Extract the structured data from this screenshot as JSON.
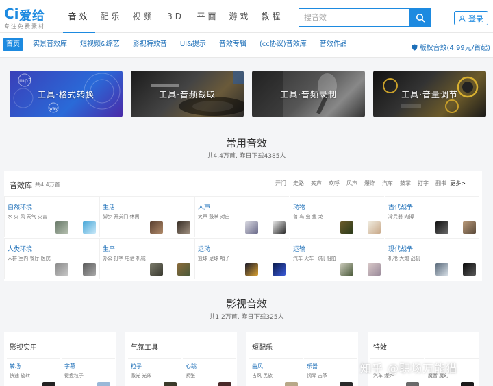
{
  "brand": {
    "logo_mark": "Ci",
    "name": "爱给",
    "slogan": "专注免费素材"
  },
  "nav": [
    {
      "label": "音效",
      "active": true
    },
    {
      "label": "配乐"
    },
    {
      "label": "视频"
    },
    {
      "label": "3D"
    },
    {
      "label": "平面"
    },
    {
      "label": "游戏"
    },
    {
      "label": "教程"
    }
  ],
  "search": {
    "placeholder": "搜音效",
    "value": ""
  },
  "login_label": "登录",
  "subnav": [
    {
      "label": "首页",
      "active": true
    },
    {
      "label": "实景音效库"
    },
    {
      "label": "短视频&综艺"
    },
    {
      "label": "影视特效音"
    },
    {
      "label": "UI&提示"
    },
    {
      "label": "音效专辑"
    },
    {
      "label": "(cc协议)音效库"
    },
    {
      "label": "音效作品"
    }
  ],
  "copyright_label": "版权音效(4.99元/首起)",
  "banners": [
    {
      "label": "工具·格式转换",
      "icon": "mp3-wav-icon"
    },
    {
      "label": "工具·音频截取",
      "icon": "turntable-icon"
    },
    {
      "label": "工具·音频录制",
      "icon": "microphone-icon"
    },
    {
      "label": "工具·音量调节",
      "icon": "mixer-knob-icon"
    }
  ],
  "common": {
    "title": "常用音效",
    "subtitle": "共4.4万首, 昨日下载4385人"
  },
  "library": {
    "title": "音效库",
    "count": "共4.4万首",
    "tags": [
      "开门",
      "走路",
      "笑声",
      "欢呼",
      "风声",
      "爆炸",
      "汽车",
      "鼓掌",
      "打字",
      "翻书"
    ],
    "more": "更多>",
    "cells": [
      {
        "name": "自然环境",
        "desc": "水 火 风 天气 灾害"
      },
      {
        "name": "生活",
        "desc": "脚步 开关门 休闲"
      },
      {
        "name": "人声",
        "desc": "笑声 鼓掌 对白"
      },
      {
        "name": "动物",
        "desc": "兽 鸟 虫 鱼 龙"
      },
      {
        "name": "古代战争",
        "desc": "冷兵器 肉搏"
      },
      {
        "name": "人类环境",
        "desc": "人群 室内 餐厅 医院"
      },
      {
        "name": "生产",
        "desc": "办公 打字 电话 机械"
      },
      {
        "name": "运动",
        "desc": "篮球 足球 哨子"
      },
      {
        "name": "运输",
        "desc": "汽车 火车 飞机 船舶"
      },
      {
        "name": "现代战争",
        "desc": "机枪 大炮 战机"
      }
    ]
  },
  "film": {
    "title": "影视音效",
    "subtitle": "共1.2万首, 昨日下载325人"
  },
  "cards": [
    {
      "title": "影视实用",
      "cells": [
        {
          "name": "转场",
          "desc": "快速 旋转"
        },
        {
          "name": "字幕",
          "desc": "键盘粒子"
        }
      ]
    },
    {
      "title": "气氛工具",
      "cells": [
        {
          "name": "粒子",
          "desc": "激光 光效"
        },
        {
          "name": "心跳",
          "desc": "紧张"
        }
      ]
    },
    {
      "title": "短配乐",
      "cells": [
        {
          "name": "曲风",
          "desc": "古风 民族"
        },
        {
          "name": "乐器",
          "desc": "钢琴 古筝"
        }
      ]
    },
    {
      "title": "特效",
      "cells": [
        {
          "name": "",
          "desc": "汽车 爆炸"
        },
        {
          "name": "",
          "desc": "魔音 魔幻"
        }
      ]
    }
  ],
  "watermark": "知乎 @职场万能猫",
  "colors": {
    "accent": "#1d8ae0",
    "link": "#1d6fb8",
    "background": "#f4f5f7"
  }
}
